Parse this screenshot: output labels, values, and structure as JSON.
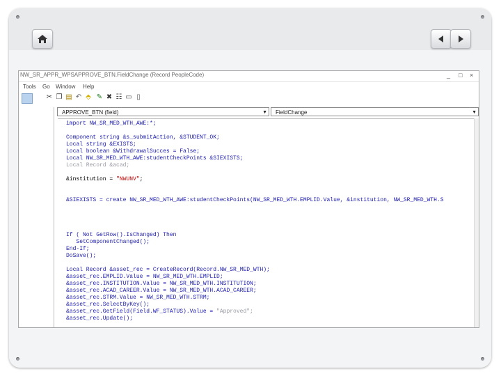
{
  "nav": {
    "home_icon": "house-icon",
    "back_icon": "left-arrow-icon",
    "forward_icon": "right-arrow-icon"
  },
  "window": {
    "title": "NW_SR_APPR_WPSAPPROVE_BTN.FieldChange (Record PeopleCode)",
    "minimize": "_",
    "maximize": "□",
    "close": "×"
  },
  "menu": [
    "Tools",
    "Go",
    "Window",
    "Help"
  ],
  "selectors": {
    "field": "APPROVE_BTN   (field)",
    "event": "FieldChange"
  },
  "code_lines": [
    [
      {
        "t": "import NW_SR_MED_WTH_AWE:*;",
        "c": "kw"
      }
    ],
    [],
    [
      {
        "t": "Component string &s_submitAction, &STUDENT_OK;",
        "c": "kw"
      }
    ],
    [
      {
        "t": "Local string &EXISTS;",
        "c": "kw"
      }
    ],
    [
      {
        "t": "Local boolean &WithdrawalSucces = False;",
        "c": "kw"
      }
    ],
    [
      {
        "t": "Local NW_SR_MED_WTH_AWE:studentCheckPoints &SIEXISTS;",
        "c": "kw"
      }
    ],
    [
      {
        "t": "Local Record &acad;",
        "c": "dim"
      }
    ],
    [],
    [
      {
        "t": "&institution = ",
        "c": ""
      },
      {
        "t": "\"NWUNV\"",
        "c": "str"
      },
      {
        "t": ";",
        "c": ""
      }
    ],
    [],
    [],
    [
      {
        "t": "&SIEXISTS = create NW_SR_MED_WTH_AWE:studentCheckPoints(NW_SR_MED_WTH.EMPLID.Value, &institution, NW_SR_MED_WTH.S",
        "c": "kw"
      }
    ],
    [],
    [],
    [],
    [],
    [
      {
        "t": "If ( Not GetRow().IsChanged) Then",
        "c": "kw"
      }
    ],
    [
      {
        "t": "   SetComponentChanged();",
        "c": "kw"
      }
    ],
    [
      {
        "t": "End-If;",
        "c": "kw"
      }
    ],
    [
      {
        "t": "DoSave();",
        "c": "kw"
      }
    ],
    [],
    [
      {
        "t": "Local Record &asset_rec = CreateRecord(Record.NW_SR_MED_WTH);",
        "c": "kw"
      }
    ],
    [
      {
        "t": "&asset_rec.EMPLID.Value = NW_SR_MED_WTH.EMPLID;",
        "c": "kw"
      }
    ],
    [
      {
        "t": "&asset_rec.INSTITUTION.Value = NW_SR_MED_WTH.INSTITUTION;",
        "c": "kw"
      }
    ],
    [
      {
        "t": "&asset_rec.ACAD_CAREER.Value = NW_SR_MED_WTH.ACAD_CAREER;",
        "c": "kw"
      }
    ],
    [
      {
        "t": "&asset_rec.STRM.Value = NW_SR_MED_WTH.STRM;",
        "c": "kw"
      }
    ],
    [
      {
        "t": "&asset_rec.SelectByKey();",
        "c": "kw"
      }
    ],
    [
      {
        "t": "&asset_rec.GetField(Field.WF_STATUS).Value = ",
        "c": "kw"
      },
      {
        "t": "\"Approved\";",
        "c": "dim"
      }
    ],
    [
      {
        "t": "&asset_rec.Update();",
        "c": "kw"
      }
    ]
  ]
}
